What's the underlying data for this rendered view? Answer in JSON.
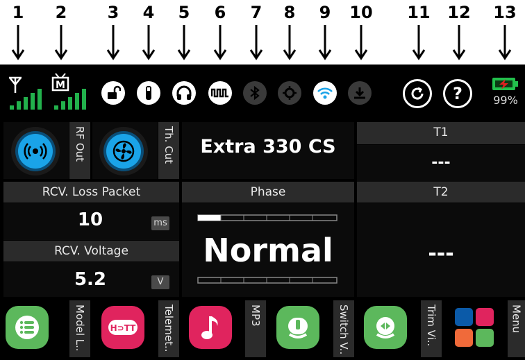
{
  "annotations": [
    "1",
    "2",
    "3",
    "4",
    "5",
    "6",
    "7",
    "8",
    "9",
    "10",
    "11",
    "12",
    "13"
  ],
  "battery": {
    "percent_label": "99%"
  },
  "panels": {
    "rf_out": {
      "label": "RF Out"
    },
    "th_cut": {
      "label": "Th. Cut"
    },
    "model_name": "Extra 330 CS",
    "t1": {
      "label": "T1",
      "value": "---"
    },
    "t2": {
      "label": "T2",
      "value": "---"
    },
    "loss_packet": {
      "label": "RCV. Loss Packet",
      "value": "10",
      "unit": "ms"
    },
    "voltage": {
      "label": "RCV. Voltage",
      "value": "5.2",
      "unit": "V"
    },
    "phase": {
      "label": "Phase",
      "value": "Normal"
    }
  },
  "apps": [
    {
      "label": "Model L..",
      "color": "#5cb85c"
    },
    {
      "label": "Telemet..",
      "color": "#e0245e"
    },
    {
      "label": "MP3",
      "color": "#e0245e"
    },
    {
      "label": "Switch V..",
      "color": "#5cb85c"
    },
    {
      "label": "Trim Vi..",
      "color": "#5cb85c"
    },
    {
      "label": "Menu",
      "color": "#000000"
    }
  ],
  "colors": {
    "signal_green": "#22b14c",
    "accent_blue": "#1aa3e8",
    "battery_green": "#22c04c",
    "battery_red": "#e02020",
    "menu_tiles": [
      "#0b5aa8",
      "#e0245e",
      "#f06a3a",
      "#5cb85c"
    ]
  },
  "icons": [
    "antenna-icon",
    "receiver-icon",
    "unlock-icon",
    "usb-icon",
    "headphones-icon",
    "trainer-icon",
    "bluetooth-icon",
    "gps-icon",
    "wifi-icon",
    "download-icon",
    "refresh-icon",
    "help-icon",
    "battery-icon"
  ]
}
